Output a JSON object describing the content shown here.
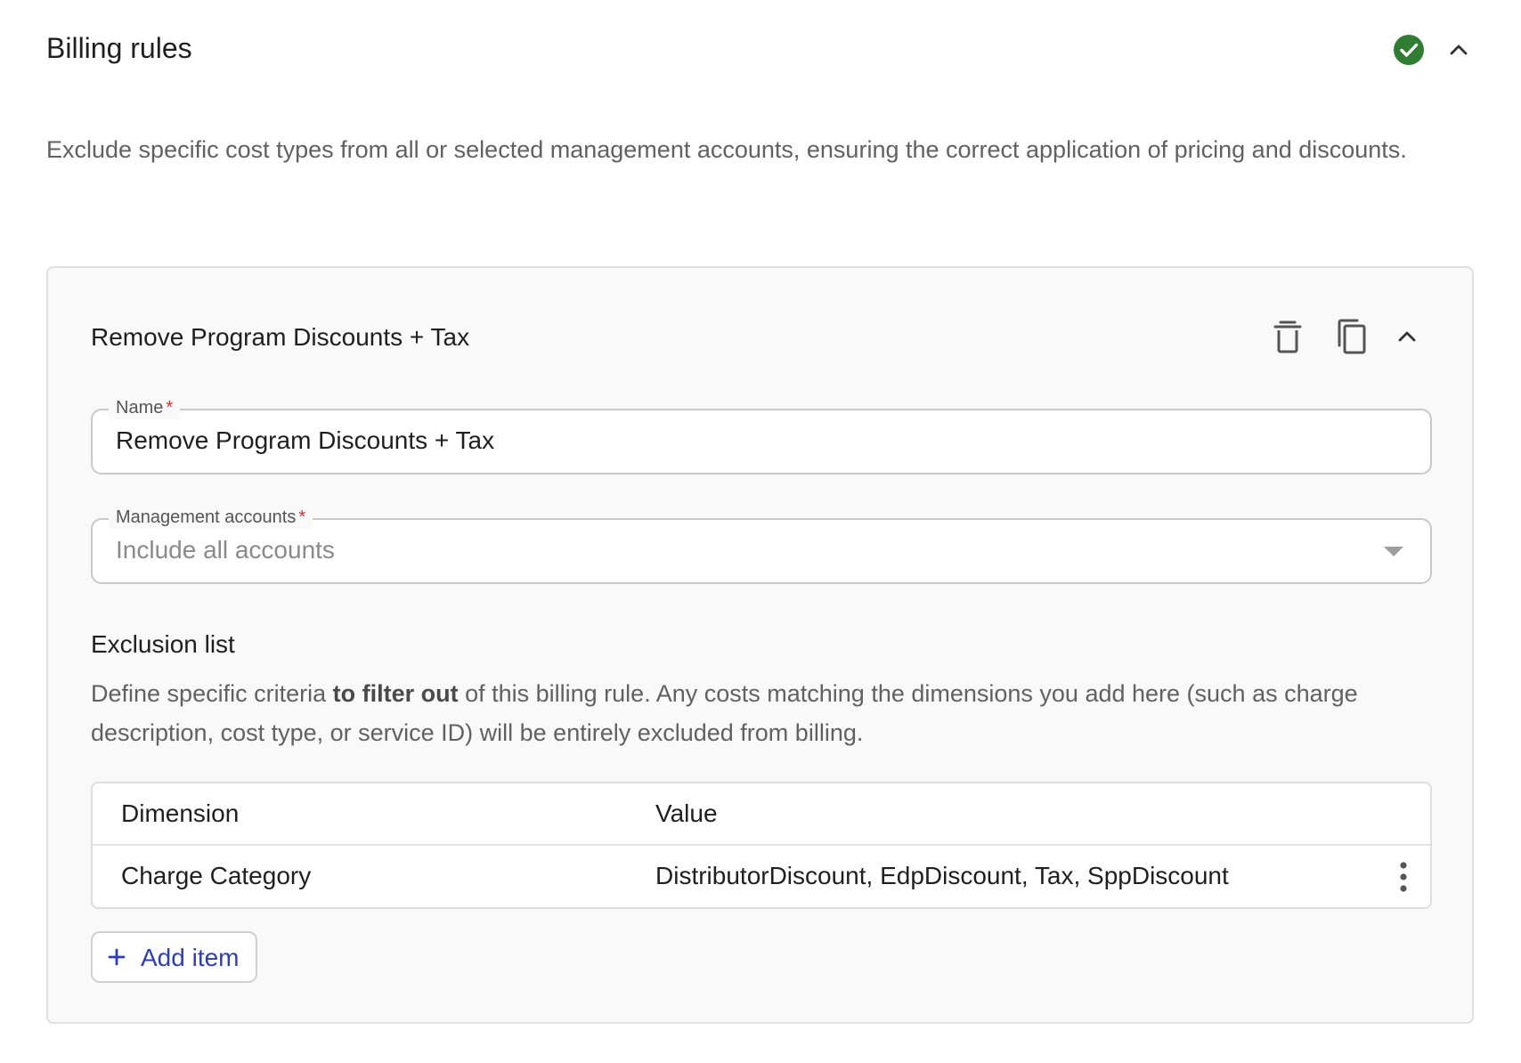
{
  "section": {
    "title": "Billing rules",
    "status_icon": "check-circle-icon",
    "description": "Exclude specific cost types from all or selected management accounts, ensuring the correct application of pricing and discounts."
  },
  "rule": {
    "title": "Remove Program Discounts + Tax",
    "actions": [
      "delete-icon",
      "copy-icon",
      "chevron-up-icon"
    ],
    "name_field": {
      "label": "Name",
      "required_mark": "*",
      "value": "Remove Program Discounts + Tax"
    },
    "accounts_field": {
      "label": "Management accounts",
      "required_mark": "*",
      "placeholder": "Include all accounts"
    },
    "exclusion": {
      "heading": "Exclusion list",
      "desc_before": "Define specific criteria ",
      "desc_bold": "to filter out",
      "desc_after": " of this billing rule. Any costs matching the dimensions you add here (such as charge description, cost type, or service ID) will be entirely excluded from billing.",
      "columns": [
        "Dimension",
        "Value"
      ],
      "rows": [
        {
          "dimension": "Charge Category",
          "value": "DistributorDiscount, EdpDiscount, Tax, SppDiscount"
        }
      ],
      "add_label": "Add item"
    }
  },
  "colors": {
    "success": "#2e7d32",
    "accent": "#2f3fb3",
    "required": "#d32f2f"
  }
}
